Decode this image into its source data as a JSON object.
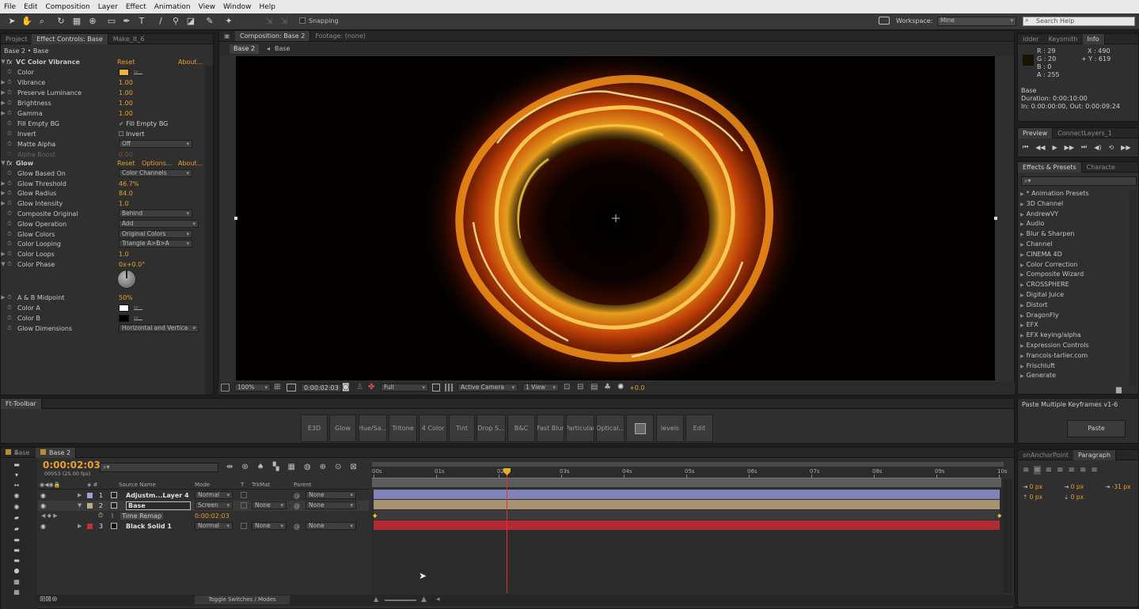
{
  "menu": [
    "File",
    "Edit",
    "Composition",
    "Layer",
    "Effect",
    "Animation",
    "View",
    "Window",
    "Help"
  ],
  "toolbar": {
    "snapping": "Snapping",
    "workspace_label": "Workspace:",
    "workspace_value": "Mine",
    "search_placeholder": "Search Help"
  },
  "left_panel": {
    "tabs": [
      "Project",
      "Effect Controls: Base",
      "Make_It_6"
    ],
    "breadcrumb": "Base 2 • Base",
    "vc": {
      "name": "VC Color Vibrance",
      "reset": "Reset",
      "about": "About...",
      "props": [
        {
          "label": "Color"
        },
        {
          "label": "Vibrance",
          "value": "1.00"
        },
        {
          "label": "Preserve Luminance",
          "value": "1.00"
        },
        {
          "label": "Brightness",
          "value": "1.00"
        },
        {
          "label": "Gamma",
          "value": "1.00"
        },
        {
          "label": "Fill Empty BG",
          "value": "Fill Empty BG"
        },
        {
          "label": "Invert",
          "value": "Invert"
        },
        {
          "label": "Matte Alpha",
          "value": "Off"
        },
        {
          "label": "Alpha Boost",
          "value": "0.00"
        }
      ],
      "color_hex": "#f0b33a"
    },
    "glow": {
      "name": "Glow",
      "reset": "Reset",
      "options": "Options...",
      "about": "About...",
      "props": [
        {
          "label": "Glow Based On",
          "value": "Color Channels"
        },
        {
          "label": "Glow Threshold",
          "value": "46.7%"
        },
        {
          "label": "Glow Radius",
          "value": "84.0"
        },
        {
          "label": "Glow Intensity",
          "value": "1.0"
        },
        {
          "label": "Composite Original",
          "value": "Behind"
        },
        {
          "label": "Glow Operation",
          "value": "Add"
        },
        {
          "label": "Glow Colors",
          "value": "Original Colors"
        },
        {
          "label": "Color Looping",
          "value": "Triangle A>B>A"
        },
        {
          "label": "Color Loops",
          "value": "1.0"
        },
        {
          "label": "Color Phase",
          "value": "0x+0.0°"
        },
        {
          "label": "A & B Midpoint",
          "value": "50%"
        },
        {
          "label": "Color A"
        },
        {
          "label": "Color B"
        },
        {
          "label": "Glow Dimensions",
          "value": "Horizontal and Vertica"
        }
      ]
    }
  },
  "comp": {
    "tab": "Composition: Base 2",
    "footage": "Footage: (none)",
    "crumbs": [
      "Base 2",
      "Base"
    ],
    "bottom": {
      "zoom": "100%",
      "time": "0:00:02:03",
      "resolution": "Full",
      "camera": "Active Camera",
      "view": "1 View",
      "exposure": "+0.0"
    }
  },
  "info": {
    "tabs": [
      "idder",
      "Keysmith",
      "Info"
    ],
    "r": "R : 29",
    "g": "G : 20",
    "b": "B : 0",
    "a": "A : 255",
    "x": "X : 490",
    "y": "+ Y : 619",
    "layer_name": "Base",
    "duration": "Duration: 0:00:10:00",
    "inout": "In: 0:00:00:00, Out: 0:00:09:24"
  },
  "preview": {
    "tabs": [
      "Preview",
      "ConnectLayers_1"
    ]
  },
  "effects": {
    "tabs": [
      "Effects & Presets",
      "Characte"
    ],
    "items": [
      "* Animation Presets",
      "3D Channel",
      "AndrewVY",
      "Audio",
      "Blur & Sharpen",
      "Channel",
      "CINEMA 4D",
      "Color Correction",
      "Composite Wizard",
      "CROSSPHERE",
      "Digital Juice",
      "Distort",
      "DragonFly",
      "EFX",
      "EFX keying/alpha",
      "Expression Controls",
      "francois-tarlier.com",
      "Frischluft",
      "Generate"
    ]
  },
  "ft_toolbar": {
    "title": "Ft-Toolbar",
    "buttons": [
      "E3D",
      "Glow",
      "Hue/Sa...",
      "Tritone",
      "4 Color",
      "Tint",
      "Drop S...",
      "B&C",
      "Fast Blur",
      "Particular",
      "Optical...",
      "",
      "levels",
      "Edit"
    ]
  },
  "paste_panel": {
    "title": "Paste Multiple Keyframes v1-6",
    "button": "Paste"
  },
  "paragraph": {
    "tabs": [
      "onAnchorPoint",
      "Paragraph"
    ],
    "fields": [
      "0 px",
      "0 px",
      "-31 px",
      "0 px",
      "0 px"
    ]
  },
  "timeline": {
    "tabs": [
      "Base",
      "Base 2"
    ],
    "timecode": "0:00:02:03",
    "fps": "00053 (25.00 fps)",
    "headers": {
      "name": "Source Name",
      "mode": "Mode",
      "t": "T",
      "trkmat": "TrkMat",
      "parent": "Parent"
    },
    "layers": [
      {
        "num": "1",
        "name": "Adjustm...Layer 4",
        "mode": "Normal",
        "trkmat": "",
        "parent": "None",
        "color": "#9f9fd6"
      },
      {
        "num": "2",
        "name": "Base",
        "mode": "Screen",
        "trkmat": "None",
        "parent": "None",
        "color": "#c2a984"
      },
      {
        "num": "",
        "name": "Time Remap",
        "value": "0:00:02:03"
      },
      {
        "num": "3",
        "name": "Black Solid 1",
        "mode": "Normal",
        "trkmat": "None",
        "parent": "None",
        "color": "#c03038"
      }
    ],
    "ruler": [
      "00s",
      "01s",
      "02s",
      "03s",
      "04s",
      "05s",
      "06s",
      "07s",
      "08s",
      "09s",
      "10s"
    ],
    "toggle": "Toggle Switches / Modes"
  }
}
